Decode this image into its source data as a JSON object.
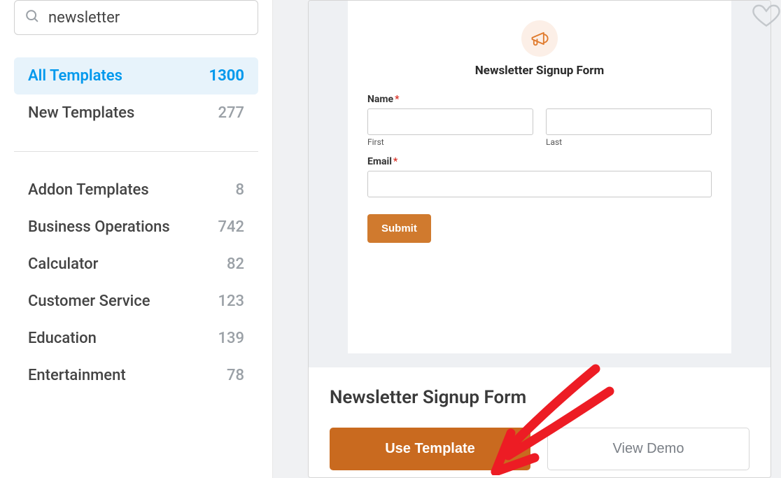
{
  "search": {
    "value": "newsletter"
  },
  "sidebar": {
    "top": [
      {
        "label": "All Templates",
        "count": "1300",
        "active": true
      },
      {
        "label": "New Templates",
        "count": "277",
        "active": false
      }
    ],
    "categories": [
      {
        "label": "Addon Templates",
        "count": "8"
      },
      {
        "label": "Business Operations",
        "count": "742"
      },
      {
        "label": "Calculator",
        "count": "82"
      },
      {
        "label": "Customer Service",
        "count": "123"
      },
      {
        "label": "Education",
        "count": "139"
      },
      {
        "label": "Entertainment",
        "count": "78"
      }
    ]
  },
  "preview": {
    "form_title": "Newsletter Signup Form",
    "name_label": "Name",
    "first_label": "First",
    "last_label": "Last",
    "email_label": "Email",
    "submit_label": "Submit"
  },
  "card": {
    "title": "Newsletter Signup Form",
    "use_label": "Use Template",
    "demo_label": "View Demo"
  }
}
